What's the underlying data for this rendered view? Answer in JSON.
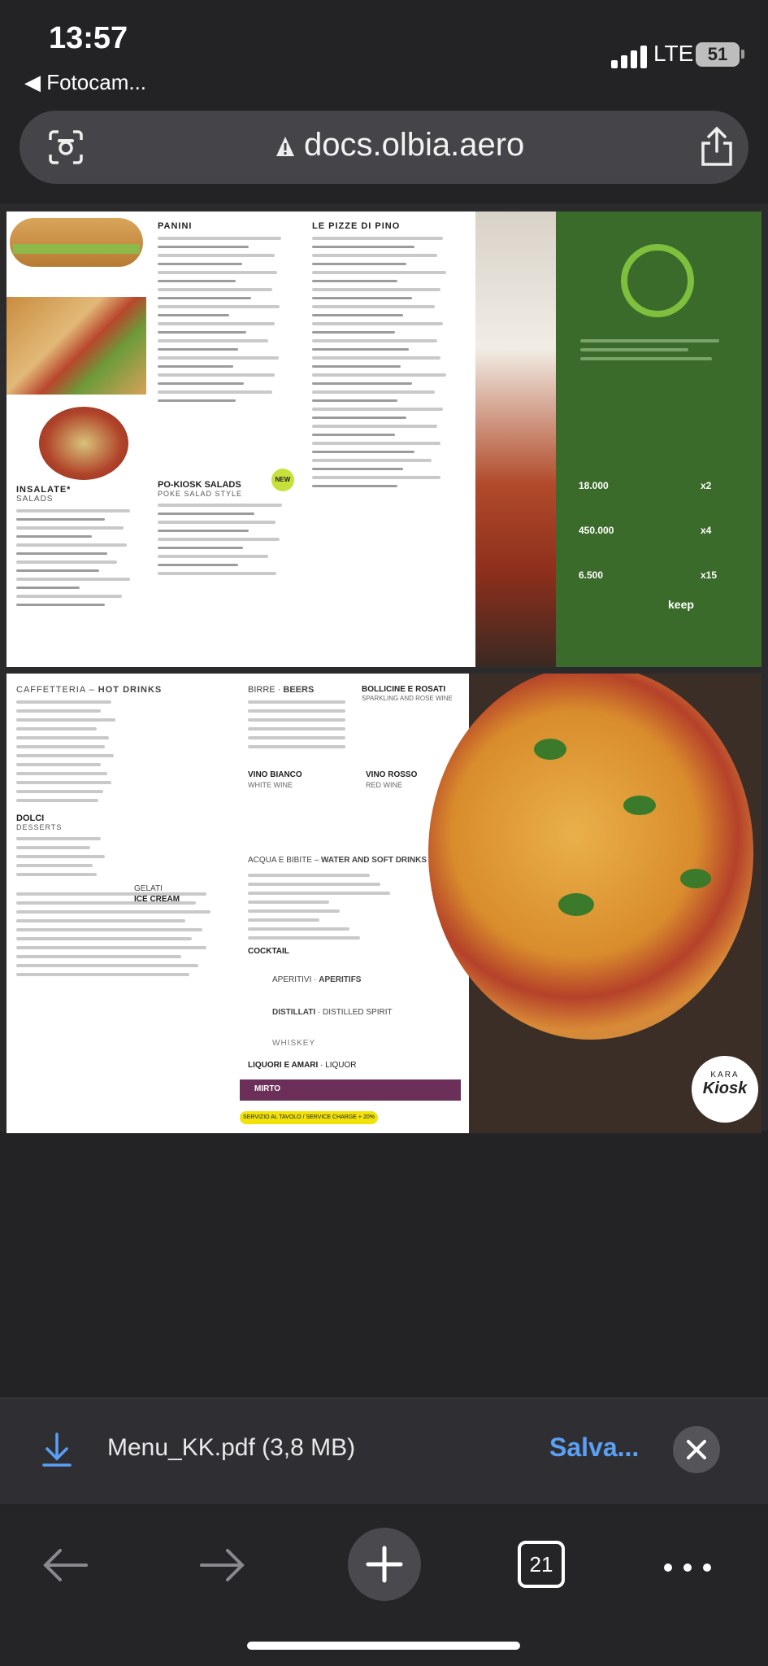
{
  "status_bar": {
    "time": "13:57",
    "back_app": "Fotocam...",
    "network": "LTE",
    "battery": "51"
  },
  "browser": {
    "url": "docs.olbia.aero"
  },
  "document": {
    "page1": {
      "panini_header": "PANINI",
      "pizze_header": "LE PIZZE DI PINO",
      "insalate_header": "INSALATE*",
      "insalate_sub": "SALADS",
      "poke_header": "PO-KIOSK SALADS",
      "poke_sub": "POKE SALAD STYLE",
      "new_badge": "NEW",
      "green_stat_1": "18.000",
      "green_stat_2": "450.000",
      "green_stat_3": "6.500",
      "green_ratio_1": "x2",
      "green_ratio_2": "x4",
      "green_ratio_3": "x15",
      "keep_logo": "keep"
    },
    "page2": {
      "caffetteria_header": "CAFFETTERIA",
      "hot_drinks": "HOT DRINKS",
      "dolci_header": "DOLCI",
      "desserts": "DESSERTS",
      "gelati_header": "GELATI",
      "ice_cream": "ICE CREAM",
      "birre_header": "BIRRE",
      "beers": "BEERS",
      "bollicine_header": "BOLLICINE E ROSATI",
      "sparkling": "SPARKLING AND ROSE WINE",
      "vino_bianco": "VINO BIANCO",
      "white_wine": "WHITE WINE",
      "vino_rosso": "VINO ROSSO",
      "red_wine": "RED WINE",
      "acqua_header": "ACQUA E BIBITE",
      "water_soft": "WATER AND SOFT DRINKS",
      "cocktail": "COCKTAIL",
      "aperitivi": "APERITIVI",
      "aperitifs": "APERITIFS",
      "distillati": "DISTILLATI",
      "distilled": "DISTILLED SPIRIT",
      "whiskey": "WHISKEY",
      "liquori": "LIQUORI E AMARI",
      "liquor": "LIQUOR",
      "mirto": "MIRTO",
      "service_charge": "SERVIZIO AL TAVOLO / SERVICE CHARGE + 20%",
      "kiosk_logo_top": "KARA",
      "kiosk_logo_main": "Kiosk"
    }
  },
  "download": {
    "file_name": "Menu_KK.pdf (3,8 MB)",
    "save_label": "Salva..."
  },
  "toolbar": {
    "tab_count": "21"
  },
  "colors": {
    "link_blue": "#5aa0f5",
    "menu_green": "#3b6b2a",
    "mirto_purple": "#6b2f5a"
  }
}
